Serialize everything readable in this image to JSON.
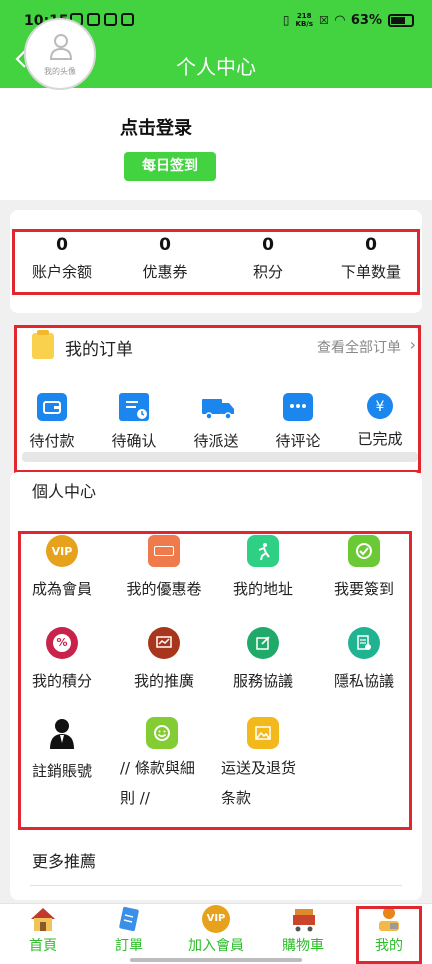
{
  "status_bar": {
    "time": "10:15",
    "speed_top": "218",
    "speed_bottom": "KB/s",
    "battery": "63%"
  },
  "header": {
    "back_icon": "back-chevron-icon",
    "title": "个人中心"
  },
  "profile": {
    "avatar_caption": "我的头像",
    "login_text": "点击登录",
    "checkin_label": "每日签到"
  },
  "stats": [
    {
      "value": "0",
      "label": "账户余额"
    },
    {
      "value": "0",
      "label": "优惠券"
    },
    {
      "value": "0",
      "label": "积分"
    },
    {
      "value": "0",
      "label": "下单数量"
    }
  ],
  "orders": {
    "title": "我的订单",
    "view_all": "查看全部订单",
    "items": [
      {
        "label": "待付款",
        "icon": "wallet-icon"
      },
      {
        "label": "待确认",
        "icon": "calendar-clock-icon"
      },
      {
        "label": "待派送",
        "icon": "truck-icon"
      },
      {
        "label": "待评论",
        "icon": "comment-icon"
      },
      {
        "label": "已完成",
        "icon": "yen-coin-icon"
      }
    ]
  },
  "personal_center": {
    "title": "個人中心",
    "items": [
      {
        "label": "成為會員",
        "icon": "vip-icon",
        "badge": "VIP",
        "color": "#e6a21c"
      },
      {
        "label": "我的優惠卷",
        "icon": "coupon-icon",
        "badge": "",
        "color": "#ef7b4c"
      },
      {
        "label": "我的地址",
        "icon": "runner-icon",
        "badge": "",
        "color": "#2fcf86"
      },
      {
        "label": "我要簽到",
        "icon": "checkin-icon",
        "badge": "",
        "color": "#6cc936"
      },
      {
        "label": "我的積分",
        "icon": "percent-icon",
        "badge": "%",
        "color": "#c8234a"
      },
      {
        "label": "我的推廣",
        "icon": "promotion-chart-icon",
        "badge": "",
        "color": "#a8361d"
      },
      {
        "label": "服務協議",
        "icon": "agreement-edit-icon",
        "badge": "",
        "color": "#1faa6a"
      },
      {
        "label": "隱私協議",
        "icon": "privacy-doc-icon",
        "badge": "",
        "color": "#1fb392"
      },
      {
        "label": "註銷賬號",
        "icon": "user-silhouette-icon",
        "badge": "",
        "color": "#111111"
      },
      {
        "label_line1": "// 條款與細",
        "label_line2": "則 //",
        "icon": "terms-smile-icon",
        "badge": "",
        "color": "#83cc34"
      },
      {
        "label_line1": "运送及退货",
        "label_line2": "条款",
        "icon": "image-icon",
        "badge": "",
        "color": "#f3b81c"
      }
    ]
  },
  "more": {
    "title": "更多推薦"
  },
  "bottom_nav": [
    {
      "label": "首頁",
      "icon": "home-icon"
    },
    {
      "label": "訂單",
      "icon": "order-list-icon"
    },
    {
      "label": "加入會員",
      "icon": "vip-member-icon",
      "badge": "VIP"
    },
    {
      "label": "購物車",
      "icon": "shopping-cart-icon"
    },
    {
      "label": "我的",
      "icon": "profile-icon"
    }
  ],
  "colors": {
    "brand_green": "#43d240",
    "highlight_red": "#e0262f",
    "nav_text": "#2dbd2a"
  }
}
